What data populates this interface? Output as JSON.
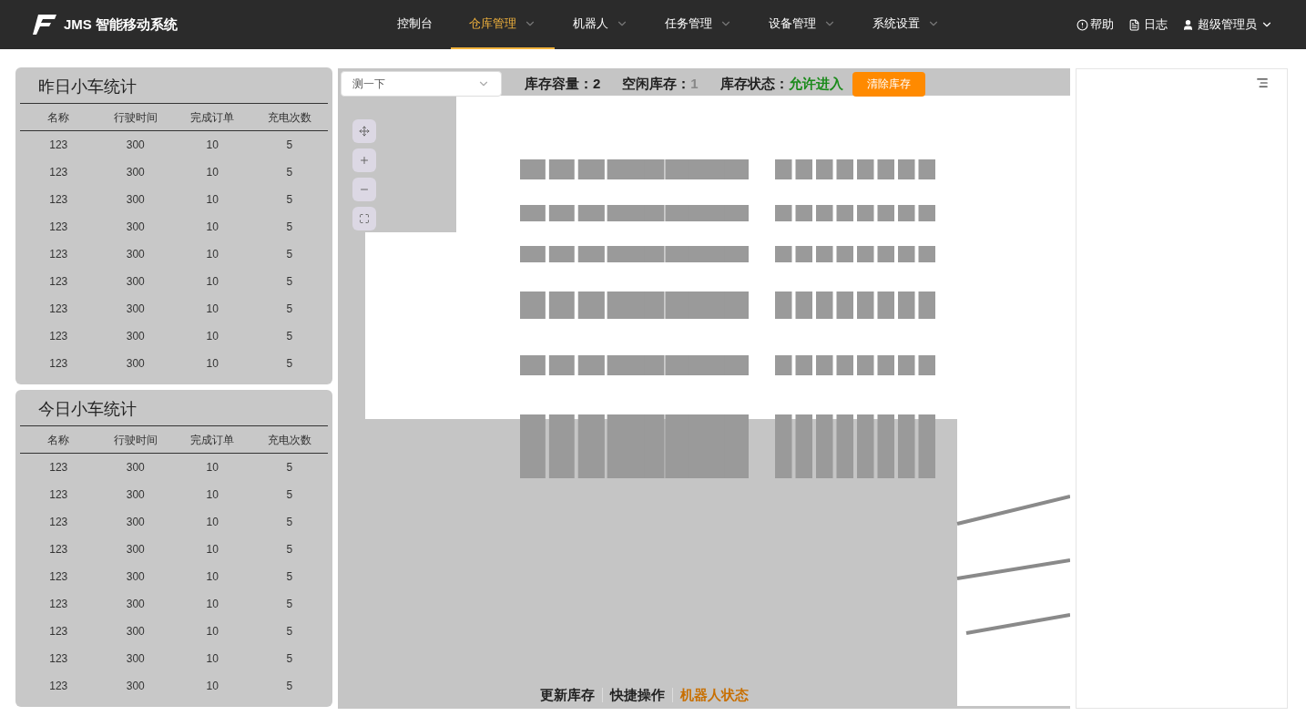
{
  "header": {
    "logo_text": "JMS 智能移动系统",
    "nav": [
      {
        "label": "控制台",
        "selected": false,
        "dropdown": false
      },
      {
        "label": "仓库管理",
        "selected": true,
        "dropdown": true
      },
      {
        "label": "机器人",
        "selected": false,
        "dropdown": true
      },
      {
        "label": "任务管理",
        "selected": false,
        "dropdown": true
      },
      {
        "label": "设备管理",
        "selected": false,
        "dropdown": true
      },
      {
        "label": "系统设置",
        "selected": false,
        "dropdown": true
      }
    ],
    "help": "帮助",
    "log": "日志",
    "user": "超级管理员"
  },
  "stat_cards": [
    {
      "title": "昨日小车统计",
      "columns": [
        "名称",
        "行驶时间",
        "完成订单",
        "充电次数"
      ],
      "rows": [
        [
          "123",
          "300",
          "10",
          "5"
        ],
        [
          "123",
          "300",
          "10",
          "5"
        ],
        [
          "123",
          "300",
          "10",
          "5"
        ],
        [
          "123",
          "300",
          "10",
          "5"
        ],
        [
          "123",
          "300",
          "10",
          "5"
        ],
        [
          "123",
          "300",
          "10",
          "5"
        ],
        [
          "123",
          "300",
          "10",
          "5"
        ],
        [
          "123",
          "300",
          "10",
          "5"
        ],
        [
          "123",
          "300",
          "10",
          "5"
        ]
      ]
    },
    {
      "title": "今日小车统计",
      "columns": [
        "名称",
        "行驶时间",
        "完成订单",
        "充电次数"
      ],
      "rows": [
        [
          "123",
          "300",
          "10",
          "5"
        ],
        [
          "123",
          "300",
          "10",
          "5"
        ],
        [
          "123",
          "300",
          "10",
          "5"
        ],
        [
          "123",
          "300",
          "10",
          "5"
        ],
        [
          "123",
          "300",
          "10",
          "5"
        ],
        [
          "123",
          "300",
          "10",
          "5"
        ],
        [
          "123",
          "300",
          "10",
          "5"
        ],
        [
          "123",
          "300",
          "10",
          "5"
        ],
        [
          "123",
          "300",
          "10",
          "5"
        ]
      ]
    }
  ],
  "map": {
    "select": {
      "value": "测一下"
    },
    "stats": [
      {
        "label": "库存容量：",
        "value": "2",
        "color": "#222222"
      },
      {
        "label": "空闲库存：",
        "value": "1",
        "color": "#888888"
      },
      {
        "label": "库存状态：",
        "value": "允许进入",
        "color": "#1a8a1a"
      }
    ],
    "clear_button": "清除库存",
    "bottom_tabs": [
      {
        "label": "更新库存",
        "selected": false
      },
      {
        "label": "快捷操作",
        "selected": false
      },
      {
        "label": "机器人状态",
        "selected": true
      }
    ]
  }
}
